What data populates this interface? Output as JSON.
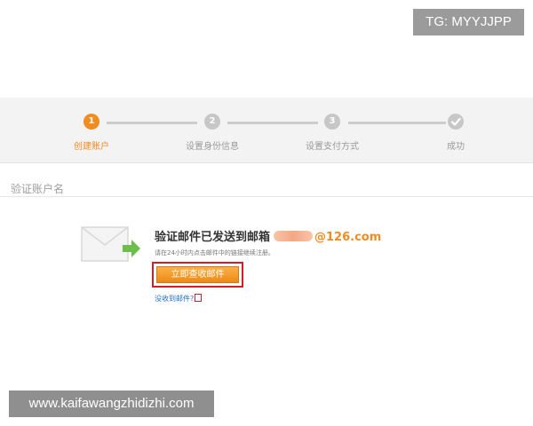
{
  "watermarks": {
    "top": "TG: MYYJJPP",
    "bottom": "www.kaifawangzhidizhi.com"
  },
  "steps": [
    {
      "number": "1",
      "label": "创建账户",
      "state": "active"
    },
    {
      "number": "2",
      "label": "设置身份信息",
      "state": "pending"
    },
    {
      "number": "3",
      "label": "设置支付方式",
      "state": "pending"
    },
    {
      "icon": "check-icon",
      "label": "成功",
      "state": "pending"
    }
  ],
  "section": {
    "title": "验证账户名"
  },
  "verify": {
    "headline": "验证邮件已发送到邮箱",
    "email_domain": "@126.com",
    "hint": "请在24小时内点击邮件中的链接继续注册。",
    "check_mail_button": "立即查收邮件",
    "resend_link": "没收到邮件?"
  },
  "colors": {
    "accent": "#f08c22",
    "highlight_box": "#c8202c",
    "link": "#1f6fc4",
    "arrow": "#6cbf4c"
  }
}
